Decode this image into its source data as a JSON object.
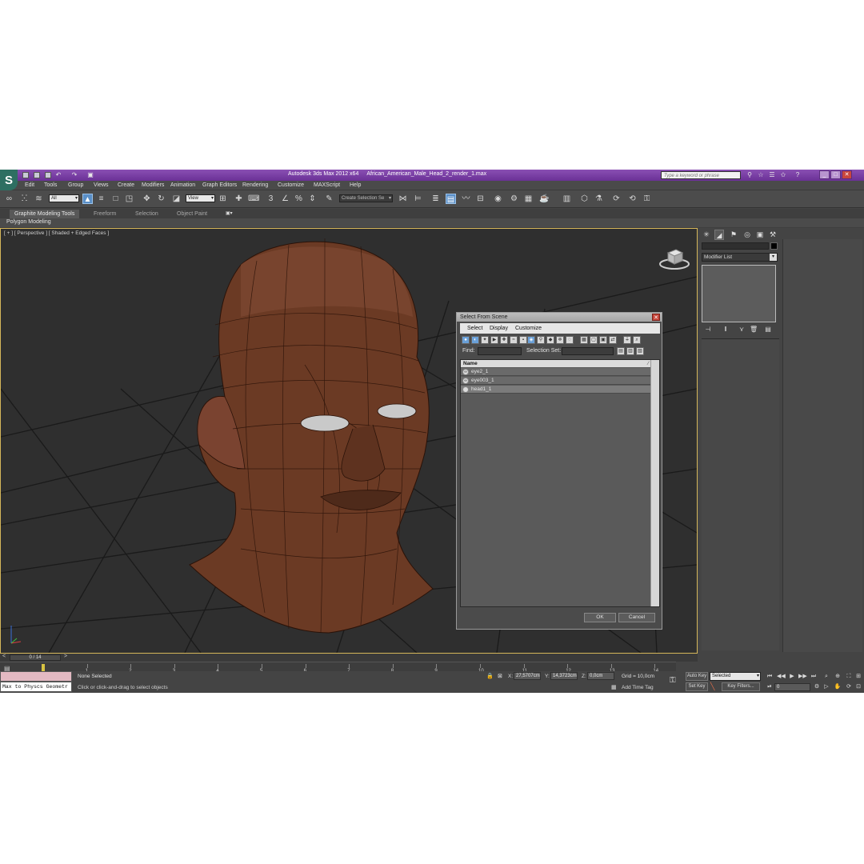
{
  "window": {
    "app_title": "Autodesk 3ds Max  2012 x64",
    "file_title": "African_American_Male_Head_2_render_1.max",
    "search_placeholder": "Type a keyword or phrase"
  },
  "menu": [
    "Edit",
    "Tools",
    "Group",
    "Views",
    "Create",
    "Modifiers",
    "Animation",
    "Graph Editors",
    "Rendering",
    "Customize",
    "MAXScript",
    "Help"
  ],
  "toolbar": {
    "filter_value": "All",
    "ref_coord_value": "View",
    "selection_set_placeholder": "Create Selection Se"
  },
  "ribbon": {
    "tabs": [
      "Graphite Modeling Tools",
      "Freeform",
      "Selection",
      "Object Paint"
    ],
    "active_panel": "Polygon Modeling"
  },
  "viewport": {
    "label": "[ + ] [ Perspective ] [ Shaded + Edged Faces ]",
    "accent_color": "#d6b75a"
  },
  "dialog": {
    "title": "Select From Scene",
    "menu": [
      "Select",
      "Display",
      "Customize"
    ],
    "find_label": "Find:",
    "selection_set_label": "Selection Set:",
    "column_name": "Name",
    "objects": [
      "eye2_1",
      "eye003_1",
      "head1_1"
    ],
    "ok_label": "OK",
    "cancel_label": "Cancel"
  },
  "command_panel": {
    "modifier_list_label": "Modifier List"
  },
  "timeline": {
    "slider_label": "0 / 14",
    "ticks": [
      "1",
      "2",
      "3",
      "4",
      "5",
      "6",
      "7",
      "8",
      "9",
      "10",
      "11",
      "12",
      "13",
      "14"
    ]
  },
  "status": {
    "maxscript_text": "Max to Physcs Geometr",
    "selection_text": "None Selected",
    "prompt_text": "Click or click-and-drag to select objects",
    "x_label": "X:",
    "x_value": "27,5707cm",
    "y_label": "Y:",
    "y_value": "14,3723cm",
    "z_label": "Z:",
    "z_value": "0,0cm",
    "grid_text": "Grid = 10,0cm",
    "add_time_tag": "Add Time Tag",
    "auto_key": "Auto Key",
    "set_key": "Set Key",
    "selected_value": "Selected",
    "key_filters": "Key Filters...",
    "frame_value": "0"
  }
}
